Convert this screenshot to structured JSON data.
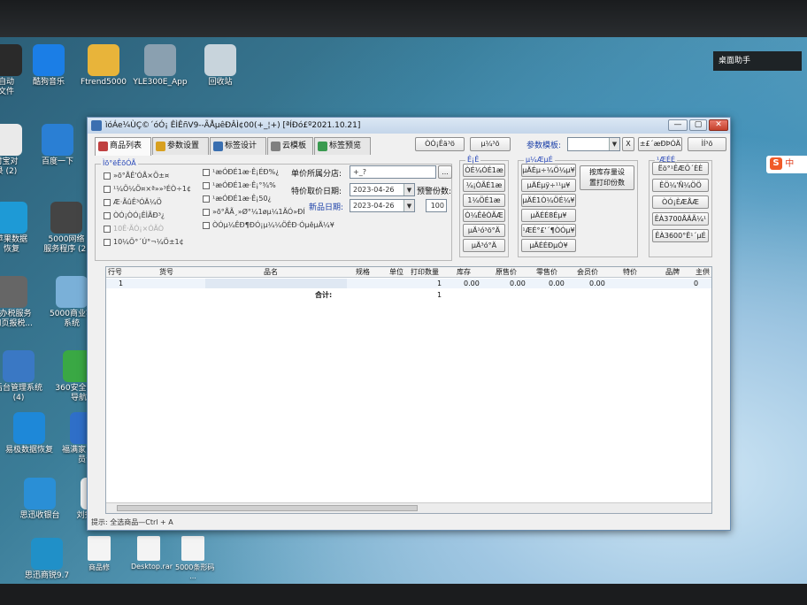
{
  "desktop": {
    "widget_title": "桌面助手",
    "icons": [
      {
        "label": "自动\n文件",
        "color": "#2a2a2a"
      },
      {
        "label": "酷狗音乐",
        "color": "#1b7ee6"
      },
      {
        "label": "Ftrend5000",
        "color": "#e8b43a"
      },
      {
        "label": "YLE300E_App",
        "color": "#8aa0b0"
      },
      {
        "label": "回收站",
        "color": "#c8d4dc"
      },
      {
        "label": "村宝对\n录 (2)",
        "color": "#eaeaea"
      },
      {
        "label": "百度一下",
        "color": "#2a7fd4"
      },
      {
        "label": "苹果数据\n恢复",
        "color": "#1e9ad6"
      },
      {
        "label": "5000网络\n服务程序 (2)",
        "color": "#444"
      },
      {
        "label": "子办税服务\n-网页报税...",
        "color": "#666"
      },
      {
        "label": "5000商业客\n系统",
        "color": "#7ab0d8"
      },
      {
        "label": "后台管理系统\n(4)",
        "color": "#3a78c4"
      },
      {
        "label": "360安全网址\n导航",
        "color": "#3aa844"
      },
      {
        "label": "易极数据恢复",
        "color": "#1e88d8"
      },
      {
        "label": "福满家电子会\n员卡",
        "color": "#2f6fc8"
      },
      {
        "label": "思迅收银台",
        "color": "#2a8fd6"
      },
      {
        "label": "刘秀承诺书",
        "color": "#f4f4f4"
      },
      {
        "label": "思迅商锐9.7",
        "color": "#2090c8"
      }
    ],
    "bottom_icons": [
      "商品修",
      "Desktop.rar",
      "5000条形码\n..."
    ],
    "ime_label": "中"
  },
  "window": {
    "title": "ìóÁe¼ÙÇ©´óÓ¡ ÊÌÊñV9--ÃÅµêÐÂÌ¢00(+_¦+) [ªÍÐó£º2021.10.21]",
    "minimize": "—",
    "maximize": "▢",
    "close": "✕",
    "tabs": [
      {
        "label": "商品列表",
        "color": "#c04040"
      },
      {
        "label": "参数设置",
        "color": "#d8a020"
      },
      {
        "label": "标签设计",
        "color": "#3a6fb0"
      },
      {
        "label": "云模板",
        "color": "#808080"
      },
      {
        "label": "标签预览",
        "color": "#3a9a50"
      }
    ],
    "toolbar": {
      "btn1": "ÒÓ¡Êä³ö",
      "btn2": "µ¼³ö",
      "template_label": "参数模板:",
      "template_value": "",
      "x_button": "X",
      "btn3": "±£´æÐÞÓÄ",
      "btn4": "ÌÍ³ö"
    },
    "options": {
      "title": "Ìõ°ëÊõÓÃ",
      "checks": [
        {
          "text": "»õ°ÅÊ'ÓÅ×Ö±¤",
          "dim": false
        },
        {
          "text": "¹¼Ö¼Ö¤×ª»»³ÉÒ÷1¢",
          "dim": false
        },
        {
          "text": "Æ·ÃûÊ³ÓÄ¼Ö",
          "dim": false
        },
        {
          "text": "ÒÓ¡ÒÓ¡ÊÌÃÐ³¿",
          "dim": false
        },
        {
          "text": "10Ê·ÃÓ¡×ÓÃÒ",
          "dim": true
        },
        {
          "text": "10¼Ö°´Ú°¬¼Ö±1¢",
          "dim": false
        }
      ],
      "checks2": [
        {
          "text": "¹æÓÐÉ1æ·Ê¡ÉÐ%¿",
          "dim": false
        },
        {
          "text": "¹æÓÐÉ1æ·Ê¡°¾%",
          "dim": false
        },
        {
          "text": "¹æÓÐÉ1æ·Ê¡50¿",
          "dim": false
        },
        {
          "text": "»õ°ÅÃ¸»Ø°¼1øµ¼1ÃÓ»ÐÍ",
          "dim": false
        },
        {
          "text": "ÒÓµ¼ÊÐ¶ÐÓ¡µ¼¼ÖÊÐ·ÓµêµÄ¼¥",
          "dim": false
        }
      ],
      "store_label": "单价所属分店:",
      "store_value": "+_?",
      "store_btn": "...",
      "special_label": "特价取价日期:",
      "special_date": "2023-04-26",
      "copies_label": "预警份数:",
      "new_label": "新品日期:",
      "new_date": "2023-04-26",
      "copies_value": "100"
    },
    "group2": {
      "title": "Ê¡Ê",
      "buttons": [
        "ÒÉ¼ÓÉ1æ",
        "¼¡ÒÃÉ1æ",
        "1¼ÖÉ1æ",
        "Ò¼ÊêÒÃÆ",
        "µÄ¹ó³ö°Ä",
        "µÄ³ó°Ä"
      ]
    },
    "group3": {
      "title": "µ¼ÆµÉ",
      "buttons": [
        "µÄÉµ÷¼Ö¼µ¥",
        "µÄÉµÿ÷¹¹µ¥",
        "µÄÉ1Ò¼ÖÉ¼¥",
        "µÄÉÉ8Éµ¥",
        "¹ÆÉ°£'´¶ÒÓµ¥",
        "µÄÉÉÐµÓ¥"
      ],
      "stock_button": "按库存量设\n置打印份数"
    },
    "group4": {
      "title": "¹ÆÉÉ",
      "buttons": [
        "Ëö°¹ÊÆÖ´ÈÈ",
        "ÊÖ¼'Ñ¼ÖÖ",
        "ÒÓ¡ÈÆÅÆ",
        "ÊÀ3700ÅÄÃ¼¹",
        "ÊÀ3600°Ë¹´µÉ"
      ]
    },
    "grid": {
      "headers": [
        "行号",
        "货号",
        "品名",
        "规格",
        "单位",
        "打印数量",
        "库存",
        "原售价",
        "零售价",
        "会员价",
        "特价",
        "品牌",
        "主供"
      ],
      "row": {
        "index": "1",
        "code": "",
        "name": "",
        "qty": "1",
        "stock": "0.00",
        "orig": "0.00",
        "retail": "0.00",
        "member": "0.00",
        "supplier": "0"
      },
      "total_label": "合计:",
      "total_qty": "1"
    },
    "status": "提示: 全选商品—Ctrl + A"
  }
}
